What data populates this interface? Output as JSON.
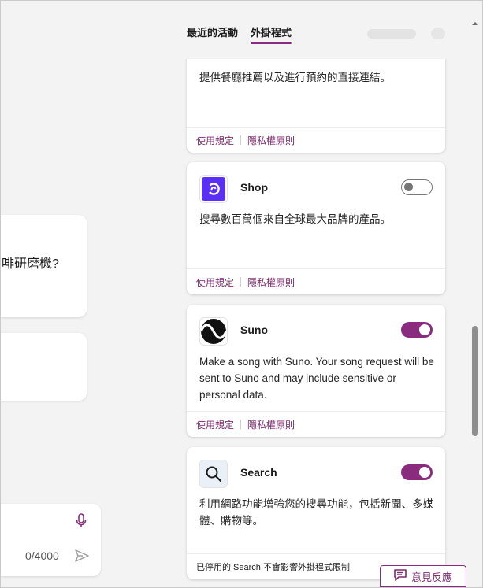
{
  "chat": {
    "message_fragment": "啡研磨機?",
    "composer": {
      "char_count": "0/4000"
    }
  },
  "tabs": [
    {
      "label": "最近的活動",
      "active": false
    },
    {
      "label": "外掛程式",
      "active": true
    }
  ],
  "plugins": [
    {
      "name": "",
      "description": "提供餐廳推薦以及進行預約的直接連結。",
      "terms": "使用規定",
      "privacy": "隱私權原則"
    },
    {
      "name": "Shop",
      "logo": "shop-logo",
      "description": "搜尋數百萬個來自全球最大品牌的產品。",
      "enabled": false,
      "terms": "使用規定",
      "privacy": "隱私權原則"
    },
    {
      "name": "Suno",
      "logo": "suno-logo",
      "description": "Make a song with Suno. Your song request will be sent to Suno and may include sensitive or personal data.",
      "enabled": true,
      "terms": "使用規定",
      "privacy": "隱私權原則"
    },
    {
      "name": "Search",
      "logo": "search-icon",
      "description": "利用網路功能增強您的搜尋功能，包括新聞、多媒體、購物等。",
      "enabled": true,
      "note": "已停用的 Search 不會影響外掛程式限制"
    }
  ],
  "feedback": {
    "label": "意見反應"
  },
  "colors": {
    "accent": "#8a2c7e",
    "shop": "#5a31f4"
  }
}
